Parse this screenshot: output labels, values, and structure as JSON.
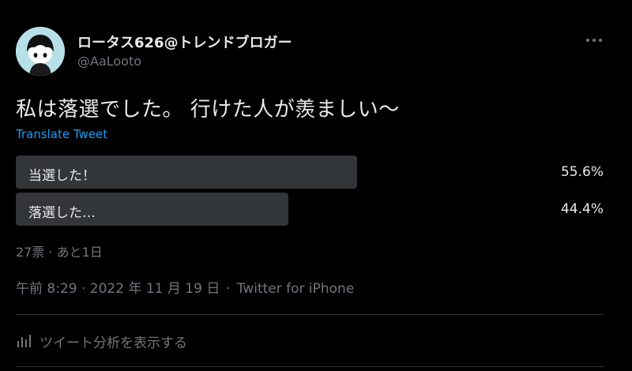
{
  "author": {
    "display_name": "ロータス626@トレンドブロガー",
    "handle": "@AaLooto",
    "avatar_icon": "avatar-character-icon"
  },
  "tweet": {
    "text": "私は落選でした。 行けた人が羨ましい〜",
    "translate_label": "Translate Tweet"
  },
  "poll": {
    "options": [
      {
        "label": "当選した！",
        "percent_text": "55.6%",
        "percent": 55.6
      },
      {
        "label": "落選した…",
        "percent_text": "44.4%",
        "percent": 44.4
      }
    ],
    "meta": "27票 · あと1日"
  },
  "timestamp": {
    "time": "午前 8:29 · 2022 年 11 月 19 日",
    "separator": "·",
    "source": "Twitter for iPhone"
  },
  "analytics": {
    "label": "ツイート分析を表示する",
    "icon": "bar-chart-icon"
  },
  "more_icon": "more-dots-icon",
  "colors": {
    "background": "#000000",
    "text": "#e7e9ea",
    "secondary_text": "#71767b",
    "link": "#1d9bf0",
    "poll_bar": "#333639",
    "avatar_bg": "#b7dfe7"
  }
}
